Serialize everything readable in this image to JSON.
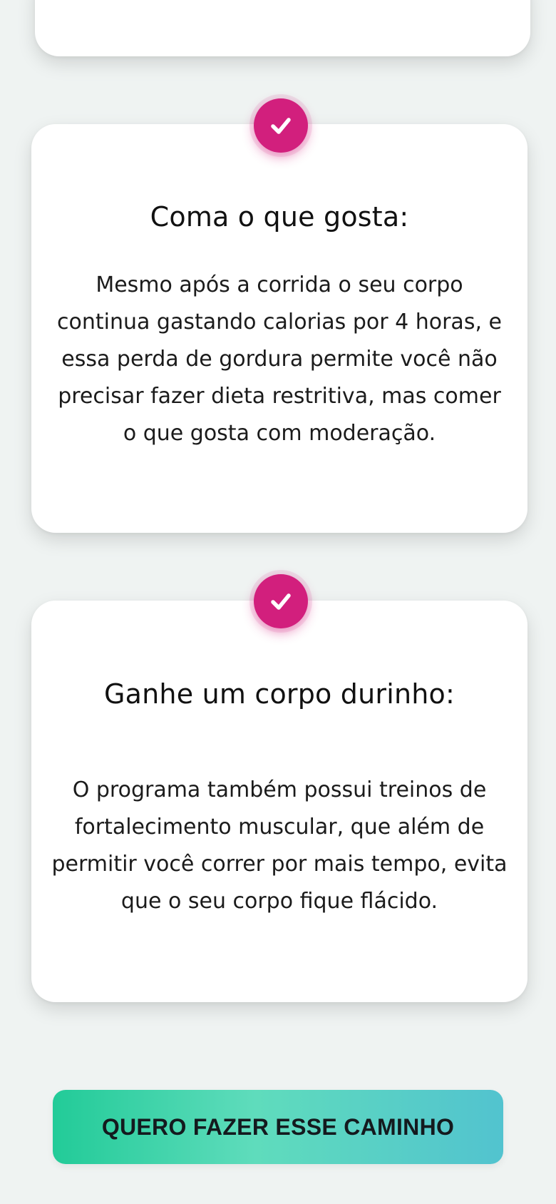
{
  "benefits": [
    {
      "title": "Coma o que gosta:",
      "text": "Mesmo após a corrida o seu corpo continua gastando calorias por 4 horas, e essa perda de gordura permite você não precisar fazer dieta restritiva, mas comer o que gosta com moderação.",
      "icon": "check-icon"
    },
    {
      "title": "Ganhe um corpo durinho:",
      "text": "O programa também possui treinos de fortalecimento muscular, que além de permitir você correr por mais tempo, evita que o seu corpo fique flácido.",
      "icon": "check-icon"
    }
  ],
  "cta": {
    "label": "QUERO FAZER ESSE CAMINHO"
  },
  "colors": {
    "background": "#eff3f2",
    "card": "#ffffff",
    "badge": "#d21f7d",
    "cta_gradient_start": "#22cb98",
    "cta_gradient_end": "#52c3cf"
  }
}
